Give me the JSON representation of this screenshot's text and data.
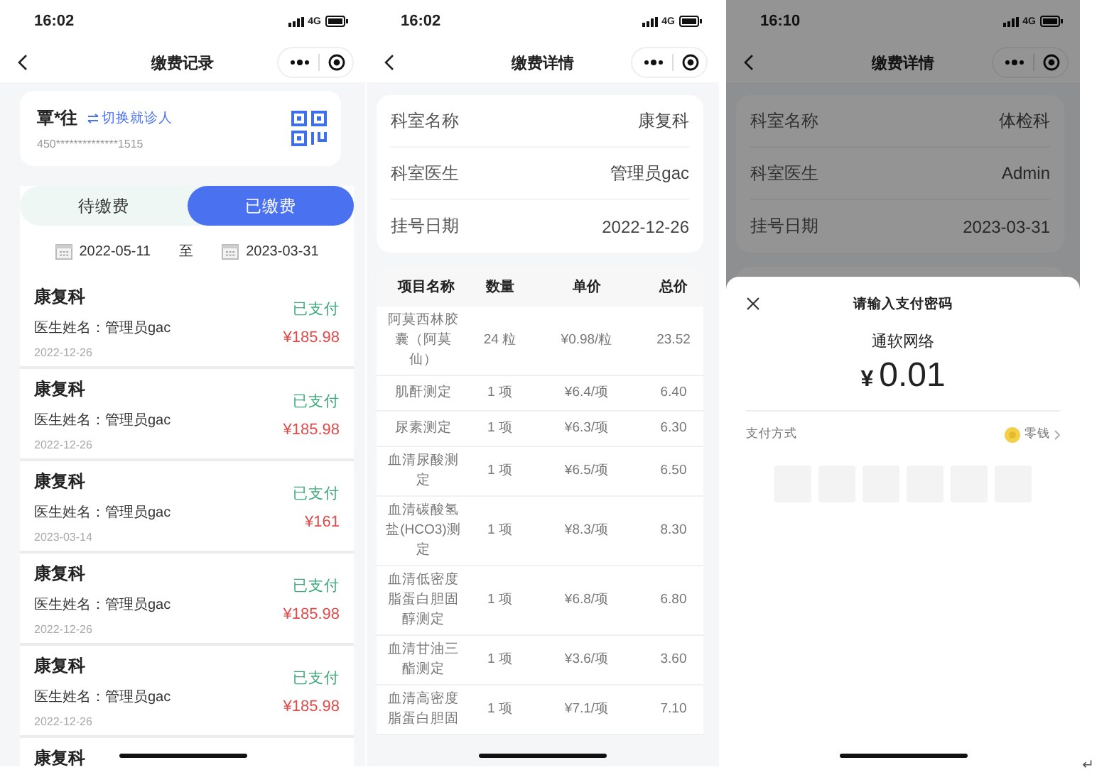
{
  "records_screen": {
    "status_bar": {
      "time": "16:02",
      "network": "4G"
    },
    "nav": {
      "title": "缴费记录"
    },
    "patient": {
      "name": "覃*往",
      "switch_link": "切换就诊人",
      "id_number": "450**************1515"
    },
    "tabs": [
      {
        "label": "待缴费",
        "selected": false
      },
      {
        "label": "已缴费",
        "selected": true
      }
    ],
    "date_range": {
      "start": "2022-05-11",
      "separator": "至",
      "end": "2023-03-31"
    },
    "records": [
      {
        "department": "康复科",
        "doctor": "医生姓名：管理员gac",
        "date": "2022-12-26",
        "status": "已支付",
        "amount": "¥185.98"
      },
      {
        "department": "康复科",
        "doctor": "医生姓名：管理员gac",
        "date": "2022-12-26",
        "status": "已支付",
        "amount": "¥185.98"
      },
      {
        "department": "康复科",
        "doctor": "医生姓名：管理员gac",
        "date": "2023-03-14",
        "status": "已支付",
        "amount": "¥161"
      },
      {
        "department": "康复科",
        "doctor": "医生姓名：管理员gac",
        "date": "2022-12-26",
        "status": "已支付",
        "amount": "¥185.98"
      },
      {
        "department": "康复科",
        "doctor": "医生姓名：管理员gac",
        "date": "2022-12-26",
        "status": "已支付",
        "amount": "¥185.98"
      },
      {
        "department": "康复科"
      }
    ]
  },
  "detail_screen": {
    "status_bar": {
      "time": "16:02",
      "network": "4G"
    },
    "nav": {
      "title": "缴费详情"
    },
    "info": [
      {
        "label": "科室名称",
        "value": "康复科"
      },
      {
        "label": "科室医生",
        "value": "管理员gac"
      },
      {
        "label": "挂号日期",
        "value": "2022-12-26"
      }
    ],
    "table": {
      "columns": [
        "项目名称",
        "数量",
        "单价",
        "总价"
      ],
      "rows": [
        {
          "name": "阿莫西林胶囊（阿莫仙）",
          "quantity": "24 粒",
          "unit_price": "¥0.98/粒",
          "total": "23.52"
        },
        {
          "name": "肌酐测定",
          "quantity": "1 项",
          "unit_price": "¥6.4/项",
          "total": "6.40"
        },
        {
          "name": "尿素测定",
          "quantity": "1 项",
          "unit_price": "¥6.3/项",
          "total": "6.30"
        },
        {
          "name": "血清尿酸测定",
          "quantity": "1 项",
          "unit_price": "¥6.5/项",
          "total": "6.50"
        },
        {
          "name": "血清碳酸氢盐(HCO3)测定",
          "quantity": "1 项",
          "unit_price": "¥8.3/项",
          "total": "8.30"
        },
        {
          "name": "血清低密度脂蛋白胆固醇测定",
          "quantity": "1 项",
          "unit_price": "¥6.8/项",
          "total": "6.80"
        },
        {
          "name": "血清甘油三酯测定",
          "quantity": "1 项",
          "unit_price": "¥3.6/项",
          "total": "3.60"
        },
        {
          "name": "血清高密度脂蛋白胆固",
          "quantity": "1 项",
          "unit_price": "¥7.1/项",
          "total": "7.10"
        }
      ]
    }
  },
  "payment_screen": {
    "status_bar": {
      "time": "16:10",
      "network": "4G"
    },
    "nav": {
      "title": "缴费详情"
    },
    "info": [
      {
        "label": "科室名称",
        "value": "体检科"
      },
      {
        "label": "科室医生",
        "value": "Admin"
      },
      {
        "label": "挂号日期",
        "value": "2023-03-31"
      }
    ],
    "sheet": {
      "title": "请输入支付密码",
      "merchant": "通软网络",
      "currency": "¥",
      "amount": "0.01",
      "method_label": "支付方式",
      "method_value": "零钱",
      "password_digits": [
        {
          "filled": false
        },
        {
          "filled": false
        },
        {
          "filled": false
        },
        {
          "filled": false
        },
        {
          "filled": false
        },
        {
          "filled": false
        }
      ]
    }
  },
  "return_mark": "↵"
}
